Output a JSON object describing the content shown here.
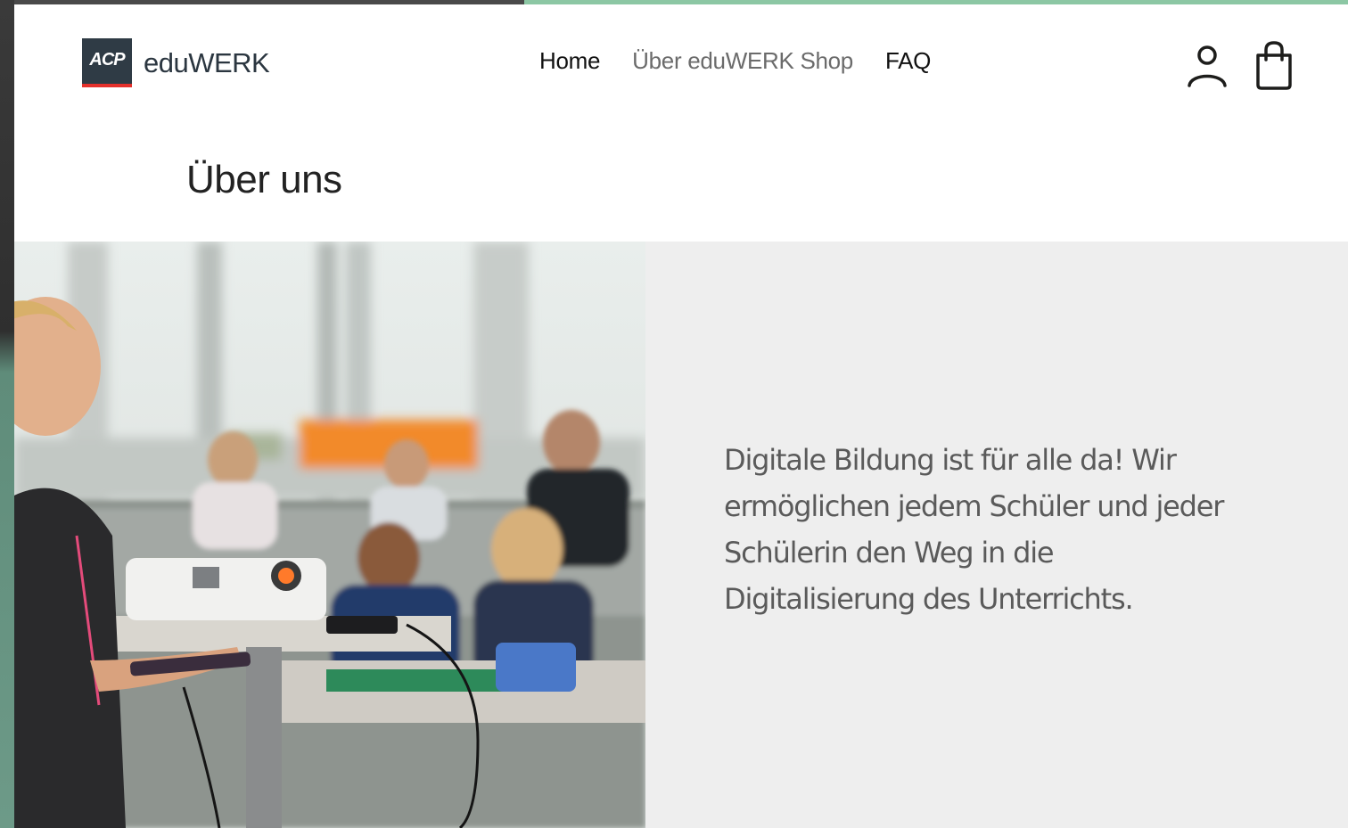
{
  "brand": {
    "logo_mark": "ACP",
    "name": "eduWERK"
  },
  "nav": {
    "items": [
      {
        "label": "Home",
        "active": true
      },
      {
        "label": "Über eduWERK Shop",
        "active": false
      },
      {
        "label": "FAQ",
        "active": true
      }
    ]
  },
  "header_icons": [
    "user-account-icon",
    "shopping-bag-icon"
  ],
  "page": {
    "title": "Über uns",
    "intro": "Digitale Bildung ist für alle da! Wir ermöglichen jedem Schüler und jeder Schülerin den Weg in die Digitalisierung des Unterrichts."
  },
  "colors": {
    "logo_bg": "#2f3b45",
    "logo_accent": "#e4302b",
    "panel_bg": "#eeeeee",
    "text_muted": "#5a5a5a"
  }
}
